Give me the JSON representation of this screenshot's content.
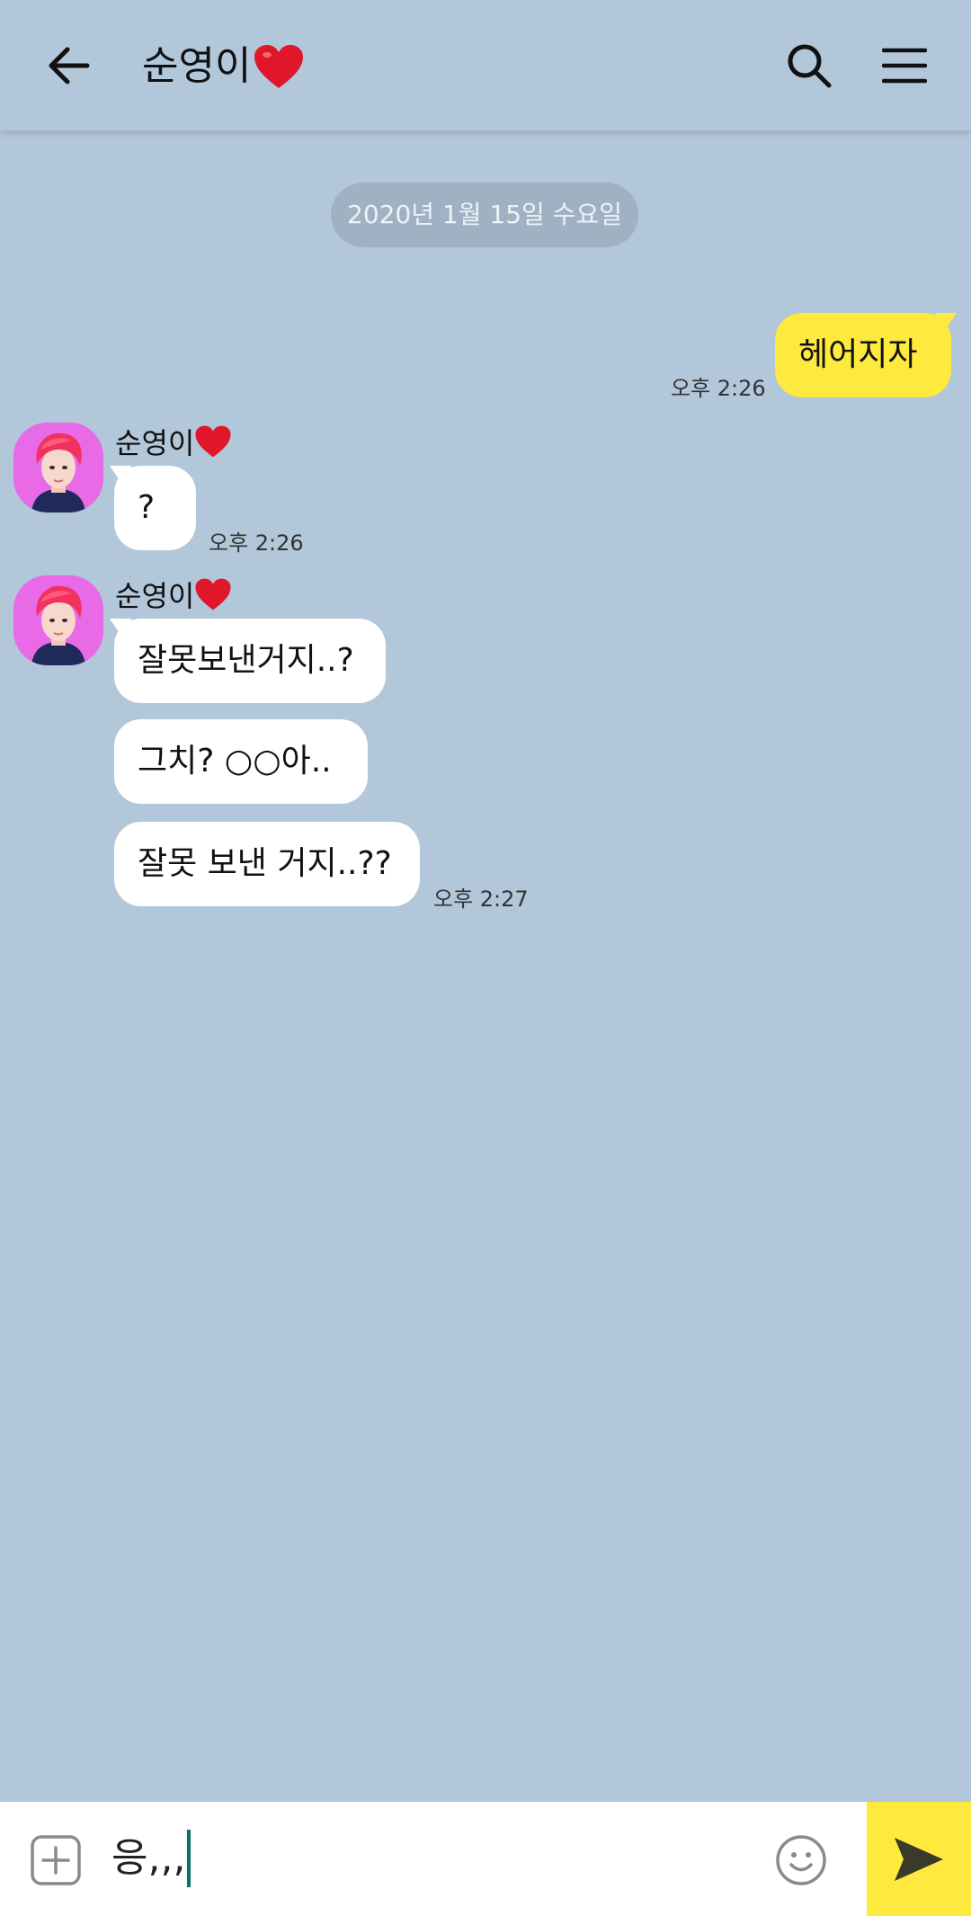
{
  "header": {
    "title": "순영이",
    "title_icon": "heart-emoji"
  },
  "date_divider": "2020년 1월 15일 수요일",
  "messages": [
    {
      "side": "mine",
      "text": "헤어지자",
      "time": "오후 2:26"
    },
    {
      "side": "theirs",
      "sender": "순영이",
      "text": "?",
      "time": "오후 2:26"
    },
    {
      "side": "theirs",
      "sender": "순영이",
      "text": "잘못보낸거지..?"
    },
    {
      "side": "theirs",
      "text": "그치? ○○아.."
    },
    {
      "side": "theirs",
      "text": "잘못 보낸 거지..??",
      "time": "오후 2:27"
    }
  ],
  "input": {
    "value": "응,,,"
  },
  "colors": {
    "background": "#b2c7da",
    "my_bubble": "#fee93f",
    "their_bubble": "#ffffff",
    "send_button": "#fee93f"
  }
}
